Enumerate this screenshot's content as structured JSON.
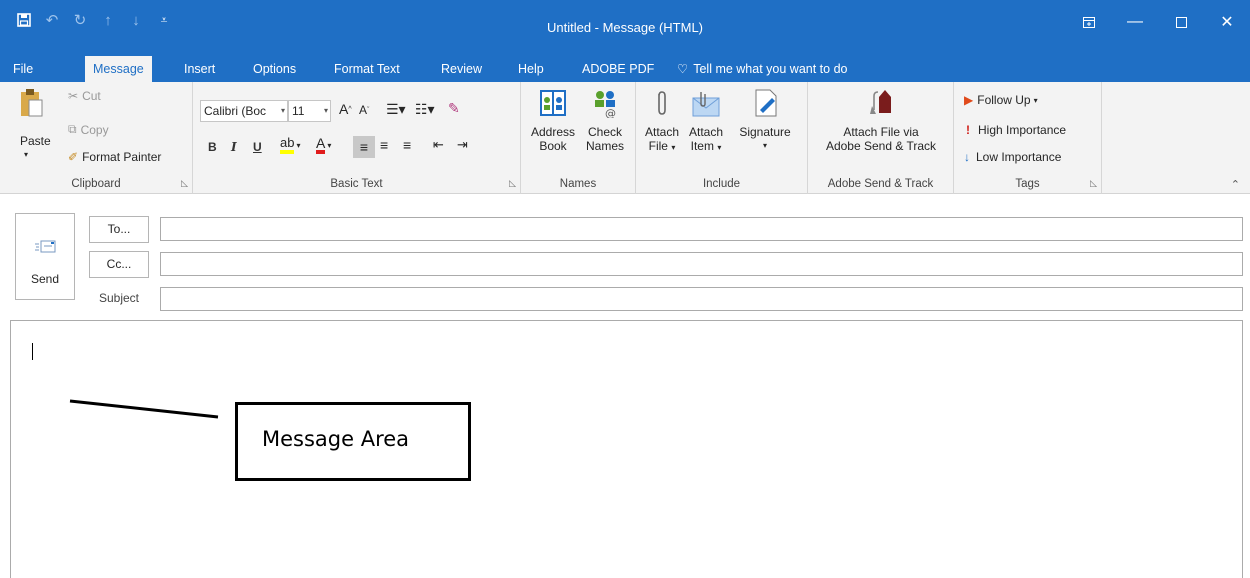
{
  "window": {
    "title": "Untitled  -  Message (HTML)"
  },
  "tabs": [
    {
      "label": "File"
    },
    {
      "label": "Message"
    },
    {
      "label": "Insert"
    },
    {
      "label": "Options"
    },
    {
      "label": "Format Text"
    },
    {
      "label": "Review"
    },
    {
      "label": "Help"
    },
    {
      "label": "ADOBE PDF"
    }
  ],
  "tell_me": "Tell me what you want to do",
  "ribbon": {
    "clipboard": {
      "label": "Clipboard",
      "paste": "Paste",
      "cut": "Cut",
      "copy": "Copy",
      "format_painter": "Format Painter"
    },
    "basic_text": {
      "label": "Basic Text",
      "font": "Calibri (Boc",
      "size": "11",
      "bold": "B",
      "italic": "I",
      "underline": "U"
    },
    "names": {
      "label": "Names",
      "address_book": [
        "Address",
        "Book"
      ],
      "check_names": [
        "Check",
        "Names"
      ]
    },
    "include": {
      "label": "Include",
      "attach_file": [
        "Attach",
        "File"
      ],
      "attach_item": [
        "Attach",
        "Item"
      ],
      "signature": "Signature"
    },
    "adobe": {
      "label": "Adobe Send & Track",
      "attach_via": [
        "Attach File via",
        "Adobe Send & Track"
      ]
    },
    "tags": {
      "label": "Tags",
      "follow_up": "Follow Up",
      "high_importance": "High Importance",
      "low_importance": "Low Importance"
    }
  },
  "compose": {
    "send": "Send",
    "to": "To...",
    "cc": "Cc...",
    "subject": "Subject",
    "to_value": "",
    "cc_value": "",
    "subject_value": ""
  },
  "annotation": {
    "label": "Message Area"
  },
  "colors": {
    "accent": "#1f6fc5",
    "ribbon_bg": "#f3f3f3"
  }
}
